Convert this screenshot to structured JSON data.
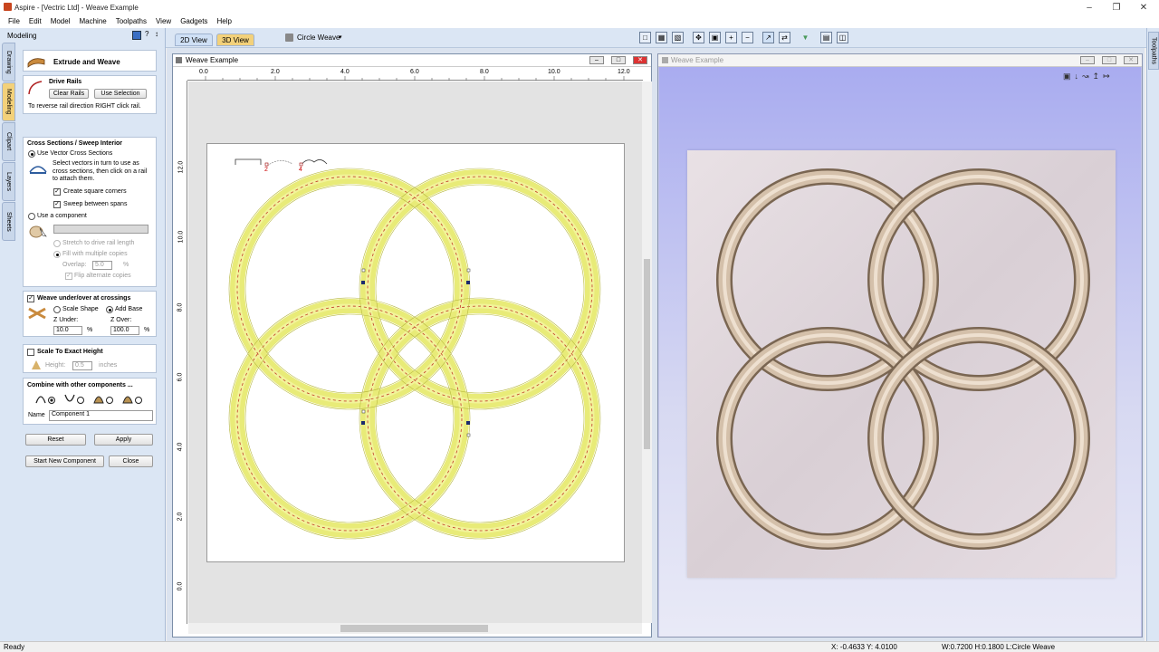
{
  "app": {
    "title": "Aspire - [Vectric Ltd] - Weave Example"
  },
  "menu": [
    "File",
    "Edit",
    "Model",
    "Machine",
    "Toolpaths",
    "View",
    "Gadgets",
    "Help"
  ],
  "left_panel": {
    "header": "Modeling",
    "side_tabs": [
      "Drawing",
      "Modeling",
      "Clipart",
      "Layers",
      "Sheets"
    ],
    "tool_title": "Extrude and Weave",
    "drive_rails": {
      "title": "Drive Rails",
      "clear_btn": "Clear Rails",
      "use_btn": "Use Selection",
      "hint": "To reverse rail direction RIGHT click rail."
    },
    "cross_sections": {
      "title": "Cross Sections / Sweep Interior",
      "use_vector": "Use Vector Cross Sections",
      "instructions": "Select vectors in turn to use as cross sections, then click on a rail to attach them.",
      "square_corners": "Create square corners",
      "sweep_spans": "Sweep between spans",
      "use_component": "Use a component",
      "stretch": "Stretch to drive rail length",
      "fill_multiple": "Fill with multiple copies",
      "overlap_label": "Overlap:",
      "overlap_value": "5.0",
      "overlap_unit": "%",
      "flip_alternate": "Flip alternate copies"
    },
    "weave": {
      "title": "Weave under/over at crossings",
      "scale_shape": "Scale Shape",
      "add_base": "Add Base",
      "z_under_label": "Z Under:",
      "z_under_value": "10.0",
      "z_over_label": "Z Over:",
      "z_over_value": "100.0",
      "unit": "%"
    },
    "scale": {
      "title": "Scale To Exact Height",
      "height_label": "Height:",
      "height_value": "0.5",
      "height_unit": "inches"
    },
    "combine": {
      "title": "Combine with other components ...",
      "name_label": "Name",
      "name_value": "Component 1"
    },
    "buttons": {
      "reset": "Reset",
      "apply": "Apply",
      "start_new": "Start New Component",
      "close": "Close"
    }
  },
  "toolbar": {
    "tab_2d": "2D View",
    "tab_3d": "3D View",
    "component_name": "Circle Weave"
  },
  "view2d": {
    "title": "Weave Example",
    "ruler_h": [
      "0.0",
      "2.0",
      "4.0",
      "6.0",
      "8.0",
      "10.0",
      "12.0"
    ],
    "ruler_v": [
      "12.0",
      "10.0",
      "8.0",
      "6.0",
      "4.0",
      "2.0",
      "0.0"
    ],
    "section_labels": [
      "2",
      "4"
    ]
  },
  "view3d": {
    "title": "Weave Example"
  },
  "right_tab": "Toolpaths",
  "status": {
    "ready": "Ready",
    "coords": "X: -0.4633 Y:  4.0100",
    "dims": "W:0.7200  H:0.1800  L:Circle Weave"
  }
}
